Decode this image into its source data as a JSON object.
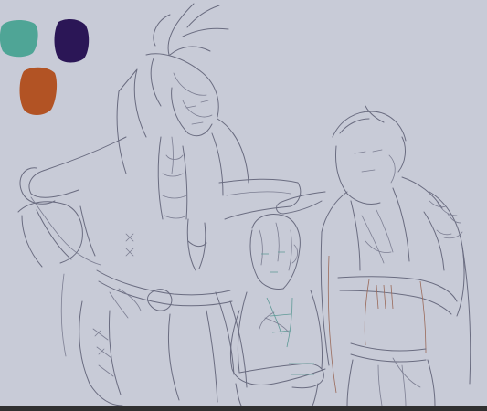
{
  "canvas": {
    "background": "#c8cbd7"
  },
  "palette": {
    "swatches": [
      {
        "name": "teal",
        "color": "#4fa596"
      },
      {
        "name": "dark-purple",
        "color": "#2b1656"
      },
      {
        "name": "burnt-orange",
        "color": "#b25324"
      }
    ]
  },
  "ui": {
    "bottom_bar_color": "#303030"
  }
}
